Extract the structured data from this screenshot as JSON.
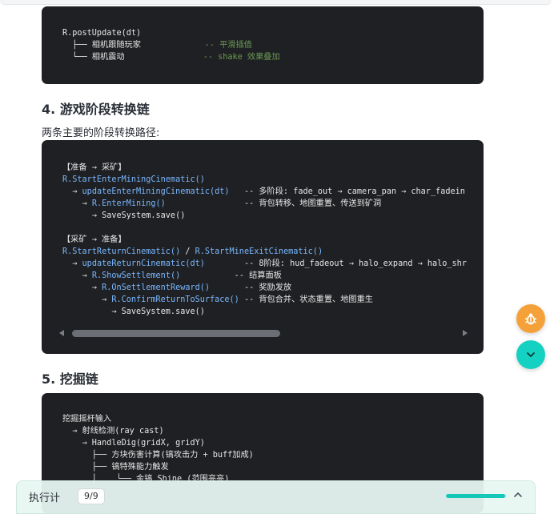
{
  "block1": {
    "lines": [
      [
        {
          "t": "R.postUpdate(dt)",
          "c": "txt"
        }
      ],
      [
        {
          "t": "  ├── 相机跟随玩家             ",
          "c": "txt"
        },
        {
          "t": "-- 平滑插值",
          "c": "cm"
        }
      ],
      [
        {
          "t": "  └── 相机震动                ",
          "c": "txt"
        },
        {
          "t": "-- shake 效果叠加",
          "c": "cm"
        }
      ]
    ]
  },
  "section4": {
    "title": "4. 游戏阶段转换链",
    "intro": "两条主要的阶段转换路径:"
  },
  "block2": {
    "lines": [
      [
        {
          "t": "【准备 → 采矿】",
          "c": "txt"
        }
      ],
      [
        {
          "t": "R.StartEnterMiningCinematic()",
          "c": "fn"
        }
      ],
      [
        {
          "t": "  → ",
          "c": "txt"
        },
        {
          "t": "updateEnterMiningCinematic(dt)",
          "c": "fn"
        },
        {
          "t": "   -- 多阶段: fade_out → camera_pan → char_fadein",
          "c": "txt"
        }
      ],
      [
        {
          "t": "    → ",
          "c": "txt"
        },
        {
          "t": "R.EnterMining()",
          "c": "fn"
        },
        {
          "t": "                -- 背包转移、地图重置、传送到矿洞",
          "c": "txt"
        }
      ],
      [
        {
          "t": "      → SaveSystem.save()",
          "c": "txt"
        }
      ],
      [
        {
          "t": "",
          "c": "txt"
        }
      ],
      [
        {
          "t": "【采矿 → 准备】",
          "c": "txt"
        }
      ],
      [
        {
          "t": "R.StartReturnCinematic()",
          "c": "fn"
        },
        {
          "t": " / ",
          "c": "txt"
        },
        {
          "t": "R.StartMineExitCinematic()",
          "c": "fn"
        }
      ],
      [
        {
          "t": "  → ",
          "c": "txt"
        },
        {
          "t": "updateReturnCinematic(dt)",
          "c": "fn"
        },
        {
          "t": "        -- 8阶段: hud_fadeout → halo_expand → halo_shr",
          "c": "txt"
        }
      ],
      [
        {
          "t": "    → ",
          "c": "txt"
        },
        {
          "t": "R.ShowSettlement()",
          "c": "fn"
        },
        {
          "t": "           -- 结算面板",
          "c": "txt"
        }
      ],
      [
        {
          "t": "      → ",
          "c": "txt"
        },
        {
          "t": "R.OnSettlementReward()",
          "c": "fn"
        },
        {
          "t": "       -- 奖励发放",
          "c": "txt"
        }
      ],
      [
        {
          "t": "        → ",
          "c": "txt"
        },
        {
          "t": "R.ConfirmReturnToSurface()",
          "c": "fn"
        },
        {
          "t": " -- 背包合并、状态重置、地图重生",
          "c": "txt"
        }
      ],
      [
        {
          "t": "          → SaveSystem.save()",
          "c": "txt"
        }
      ]
    ]
  },
  "section5": {
    "title": "5. 挖掘链"
  },
  "block3": {
    "lines": [
      [
        {
          "t": "挖掘摇杆输入",
          "c": "txt"
        }
      ],
      [
        {
          "t": "  → 射线检测(ray cast)",
          "c": "txt"
        }
      ],
      [
        {
          "t": "    → HandleDig(gridX, gridY)",
          "c": "txt"
        }
      ],
      [
        {
          "t": "      ├── 方块伤害计算(镐攻击力 + buff加成)",
          "c": "txt"
        }
      ],
      [
        {
          "t": "      ├── 镐特殊能力触发",
          "c": "txt"
        }
      ],
      [
        {
          "t": "      │    └── 金镐 Shine (范围亮亮)",
          "c": "txt"
        }
      ]
    ]
  },
  "statusbar": {
    "label": "执行计",
    "badge": "9/9",
    "progress": 0.97
  },
  "colors": {
    "code_bg": "#1f2023",
    "fn": "#79b8ff",
    "comment": "#6a9955",
    "bug_fab": "#f5a13a",
    "down_fab": "#14d1c2",
    "accent": "#14c7b8"
  },
  "icons": {
    "bug_fab": "bug-icon",
    "down_fab": "chevron-down-icon",
    "status": "chevron-up-icon"
  }
}
